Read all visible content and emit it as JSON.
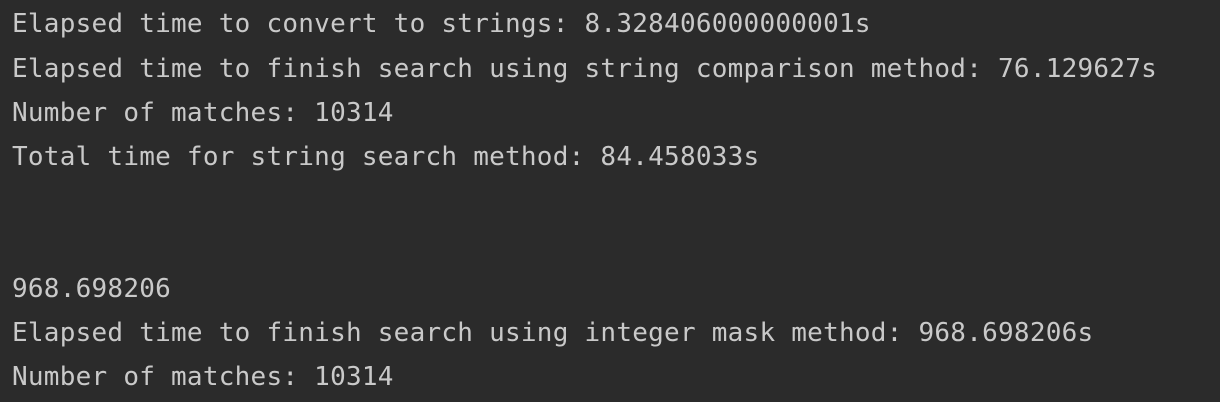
{
  "console": {
    "lines": [
      "Elapsed time to convert to strings: 8.328406000000001s",
      "Elapsed time to finish search using string comparison method: 76.129627s",
      "Number of matches: 10314",
      "Total time for string search method: 84.458033s",
      "968.698206",
      "Elapsed time to finish search using integer mask method: 968.698206s",
      "Number of matches: 10314"
    ]
  },
  "colors": {
    "background": "#2b2b2b",
    "text": "#c9c9c9"
  }
}
